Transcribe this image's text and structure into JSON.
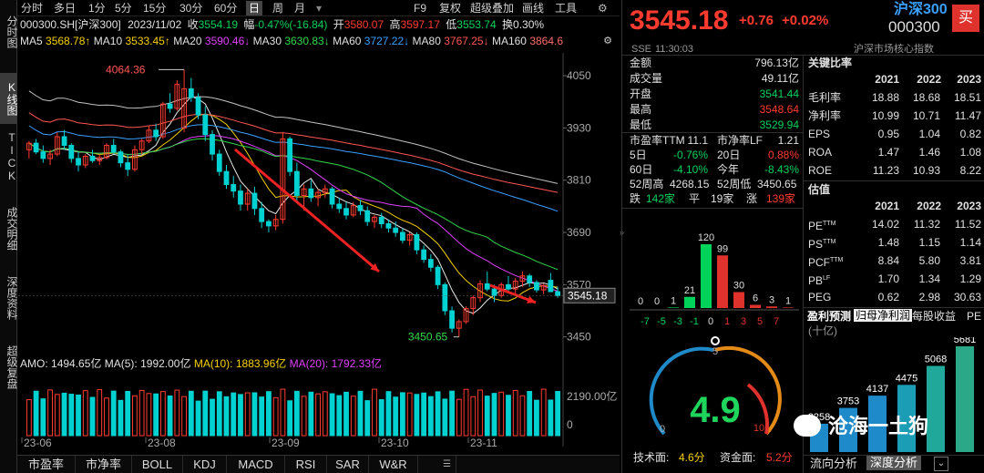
{
  "left_nav": [
    "分时图",
    "K线图",
    "TICK",
    "成交明细",
    "深度资料",
    "超级复盘"
  ],
  "toolbar": {
    "periods": [
      "分时",
      "多日",
      "1分",
      "5分",
      "15分",
      "30分",
      "60分",
      "日",
      "周",
      "月"
    ],
    "active": "日",
    "right": [
      "F9",
      "复权",
      "超级叠加",
      "画线",
      "工具"
    ],
    "settings_icon": "gear-icon"
  },
  "quote_line": {
    "code": "000300.SH[沪深300]",
    "date": "2023/11/02",
    "close_label": "收",
    "close": "3554.19",
    "change_label": "幅",
    "change": "-0.47%(-16.84)",
    "open_label": "开",
    "open": "3580.07",
    "high_label": "高",
    "high": "3597.17",
    "low_label": "低",
    "low": "3553.74",
    "turnover_label": "换",
    "turnover": "0.30%"
  },
  "ma_line": [
    {
      "label": "MA5",
      "value": "3568.78↑"
    },
    {
      "label": "MA10",
      "value": "3533.45↑"
    },
    {
      "label": "MA20",
      "value": "3590.46↓"
    },
    {
      "label": "MA30",
      "value": "3630.83↓"
    },
    {
      "label": "MA60",
      "value": "3727.22↓"
    },
    {
      "label": "MA80",
      "value": "3767.25↓"
    },
    {
      "label": "MA160",
      "value": "3864.6"
    }
  ],
  "chart_data": {
    "type": "candlestick",
    "ylim": [
      3420,
      4090
    ],
    "yticks": [
      "4050",
      "3930",
      "3810",
      "3690",
      "3570",
      "3450"
    ],
    "xticks": [
      "23-06",
      "23-08",
      "23-09",
      "23-10",
      "23-11"
    ],
    "current_price_tag": "3545.18",
    "high_annotation": "4064.36",
    "low_annotation": "3450.65",
    "candles": [
      [
        3880,
        3900,
        3860,
        3895
      ],
      [
        3895,
        3905,
        3870,
        3875
      ],
      [
        3875,
        3890,
        3850,
        3860
      ],
      [
        3860,
        3880,
        3845,
        3870
      ],
      [
        3870,
        3920,
        3865,
        3910
      ],
      [
        3910,
        3925,
        3880,
        3890
      ],
      [
        3890,
        3895,
        3850,
        3860
      ],
      [
        3860,
        3875,
        3830,
        3845
      ],
      [
        3845,
        3870,
        3838,
        3865
      ],
      [
        3865,
        3880,
        3850,
        3855
      ],
      [
        3855,
        3870,
        3845,
        3862
      ],
      [
        3862,
        3895,
        3858,
        3890
      ],
      [
        3890,
        3905,
        3870,
        3875
      ],
      [
        3875,
        3880,
        3840,
        3850
      ],
      [
        3850,
        3868,
        3820,
        3835
      ],
      [
        3835,
        3890,
        3830,
        3880
      ],
      [
        3880,
        3905,
        3870,
        3900
      ],
      [
        3900,
        3935,
        3895,
        3925
      ],
      [
        3925,
        3940,
        3900,
        3910
      ],
      [
        3910,
        3990,
        3905,
        3985
      ],
      [
        3985,
        4010,
        3965,
        3975
      ],
      [
        3975,
        4040,
        3970,
        4030
      ],
      [
        3930,
        4064,
        3920,
        4020
      ],
      [
        4020,
        4045,
        3990,
        4000
      ],
      [
        4000,
        4010,
        3950,
        3960
      ],
      [
        3960,
        3980,
        3900,
        3915
      ],
      [
        3915,
        3925,
        3855,
        3870
      ],
      [
        3870,
        3880,
        3820,
        3830
      ],
      [
        3830,
        3845,
        3790,
        3800
      ],
      [
        3800,
        3820,
        3770,
        3785
      ],
      [
        3785,
        3800,
        3740,
        3755
      ],
      [
        3755,
        3790,
        3740,
        3780
      ],
      [
        3780,
        3795,
        3730,
        3745
      ],
      [
        3745,
        3760,
        3700,
        3715
      ],
      [
        3715,
        3720,
        3690,
        3705
      ],
      [
        3705,
        3730,
        3695,
        3720
      ],
      [
        3720,
        3920,
        3710,
        3905
      ],
      [
        3905,
        3910,
        3820,
        3830
      ],
      [
        3830,
        3850,
        3760,
        3775
      ],
      [
        3775,
        3800,
        3740,
        3790
      ],
      [
        3790,
        3810,
        3760,
        3770
      ],
      [
        3770,
        3790,
        3750,
        3782
      ],
      [
        3782,
        3800,
        3770,
        3790
      ],
      [
        3790,
        3795,
        3745,
        3755
      ],
      [
        3755,
        3770,
        3735,
        3745
      ],
      [
        3745,
        3760,
        3720,
        3730
      ],
      [
        3730,
        3760,
        3725,
        3752
      ],
      [
        3752,
        3765,
        3730,
        3740
      ],
      [
        3740,
        3750,
        3705,
        3715
      ],
      [
        3715,
        3730,
        3700,
        3725
      ],
      [
        3725,
        3735,
        3700,
        3710
      ],
      [
        3710,
        3720,
        3690,
        3700
      ],
      [
        3700,
        3715,
        3680,
        3690
      ],
      [
        3690,
        3700,
        3665,
        3672
      ],
      [
        3672,
        3690,
        3660,
        3685
      ],
      [
        3685,
        3690,
        3640,
        3650
      ],
      [
        3650,
        3660,
        3620,
        3628
      ],
      [
        3628,
        3640,
        3600,
        3610
      ],
      [
        3610,
        3615,
        3560,
        3570
      ],
      [
        3570,
        3575,
        3500,
        3510
      ],
      [
        3510,
        3520,
        3460,
        3470
      ],
      [
        3470,
        3490,
        3450,
        3485
      ],
      [
        3485,
        3520,
        3480,
        3515
      ],
      [
        3515,
        3545,
        3500,
        3540
      ],
      [
        3540,
        3580,
        3530,
        3572
      ],
      [
        3572,
        3600,
        3555,
        3560
      ],
      [
        3560,
        3570,
        3530,
        3545
      ],
      [
        3545,
        3575,
        3540,
        3570
      ],
      [
        3570,
        3590,
        3555,
        3560
      ],
      [
        3560,
        3585,
        3550,
        3578
      ],
      [
        3578,
        3600,
        3565,
        3590
      ],
      [
        3590,
        3595,
        3565,
        3575
      ],
      [
        3575,
        3580,
        3552,
        3558
      ],
      [
        3558,
        3572,
        3548,
        3568
      ],
      [
        3580,
        3597,
        3553,
        3554
      ],
      [
        3554,
        3565,
        3540,
        3545
      ]
    ]
  },
  "volume": {
    "label_amo": "AMO:",
    "amo": "1494.65亿",
    "ma5_label": "MA(5):",
    "ma5": "1992.00亿",
    "ma10_label": "MA(10):",
    "ma10": "1883.96亿",
    "ma20_label": "MA(20):",
    "ma20": "1792.33亿",
    "ytick": "2190.00亿",
    "y0": "0"
  },
  "bottom_tabs": [
    "市盈率",
    "市净率",
    "BOLL",
    "KDJ",
    "MACD",
    "RSI",
    "SAR",
    "W&R"
  ],
  "quote_panel": {
    "price": "3545.18",
    "change": "+0.76",
    "pct": "+0.02%",
    "name": "沪深300",
    "code": "000300",
    "buy": "买",
    "exchange": "SSE",
    "time": "11:30:03",
    "tag": "沪深市场核心指数",
    "fields": [
      {
        "label": "金额",
        "value": "796.13亿",
        "cls": "wh"
      },
      {
        "label": "成交量",
        "value": "49.11亿",
        "cls": "wh"
      },
      {
        "label": "开盘",
        "value": "3541.44",
        "cls": "dn"
      },
      {
        "label": "最高",
        "value": "3548.64",
        "cls": "up"
      },
      {
        "label": "最低",
        "value": "3529.94",
        "cls": "dn"
      }
    ],
    "pe_ttm_label": "市盈率TTM",
    "pe_ttm": "11.1",
    "pb_lf_label": "市净率LF",
    "pb_lf": "1.21",
    "d5_label": "5日",
    "d5": "-0.76%",
    "d20_label": "20日",
    "d20": "0.88%",
    "d60_label": "60日",
    "d60": "-4.10%",
    "ytd_label": "今年",
    "ytd": "-8.43%",
    "w52h_label": "52周高",
    "w52h": "4268.15",
    "w52l_label": "52周低",
    "w52l": "3450.65",
    "fall_label": "跌",
    "fall": "142家",
    "flat_label": "平",
    "flat": "19家",
    "rise_label": "涨",
    "rise": "139家"
  },
  "distribution": {
    "values": [
      0,
      0,
      1,
      21,
      120,
      99,
      30,
      6,
      3,
      1
    ],
    "labels": [
      "-7",
      "-5",
      "-3",
      "-1",
      "0",
      "1",
      "3",
      "5",
      "7"
    ]
  },
  "gauge": {
    "value": "4.9",
    "min": "0",
    "mid": "5",
    "max": "10",
    "tech_label": "技术面:",
    "tech": "4.6分",
    "fund_label": "资金面:",
    "fund": "5.2分"
  },
  "key_ratios": {
    "title": "关键比率",
    "years": [
      "2021",
      "2022",
      "2023"
    ],
    "rows": [
      {
        "label": "毛利率",
        "v": [
          "18.88",
          "18.68",
          "18.51"
        ]
      },
      {
        "label": "净利率",
        "v": [
          "10.99",
          "10.71",
          "11.47"
        ]
      },
      {
        "label": "EPS",
        "v": [
          "0.95",
          "1.04",
          "0.82"
        ]
      },
      {
        "label": "ROA",
        "v": [
          "1.47",
          "1.46",
          "1.08"
        ]
      },
      {
        "label": "ROE",
        "v": [
          "11.23",
          "10.93",
          "8.22"
        ]
      }
    ]
  },
  "valuation": {
    "title": "估值",
    "years": [
      "2021",
      "2022",
      "2023"
    ],
    "rows": [
      {
        "label": "PE",
        "sup": "TTM",
        "v": [
          "14.02",
          "11.32",
          "11.52"
        ]
      },
      {
        "label": "PS",
        "sup": "TTM",
        "v": [
          "1.48",
          "1.15",
          "1.14"
        ]
      },
      {
        "label": "PCF",
        "sup": "TTM",
        "v": [
          "8.84",
          "5.80",
          "3.81"
        ]
      },
      {
        "label": "PB",
        "sup": "LF",
        "v": [
          "1.70",
          "1.34",
          "1.29"
        ]
      },
      {
        "label": "PEG",
        "sup": "",
        "v": [
          "0.62",
          "2.98",
          "30.63"
        ]
      }
    ]
  },
  "forecast": {
    "tabs": [
      "盈利预测",
      "归母净利润",
      "每股收益",
      "PE"
    ],
    "unit": "(十亿)",
    "values": [
      3258,
      3753,
      4137,
      4475,
      5068,
      5681
    ],
    "labels": [
      "3258",
      "3753",
      "4137",
      "4475",
      "5068",
      "5681"
    ]
  },
  "watermark": "沧海一土狗",
  "right_bottom_tabs": [
    "流向分析",
    "深度分析"
  ]
}
